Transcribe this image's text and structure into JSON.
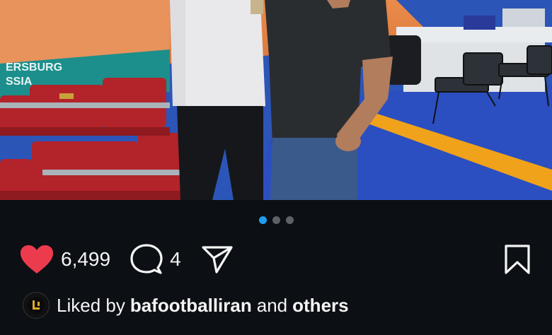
{
  "post": {
    "photo_alt": "Two men standing beside volleyball court seating",
    "arena_banner_text": "ERSBURG\nSSIA",
    "carousel": {
      "total": 3,
      "active_index": 0
    },
    "actions": {
      "likes_count": "6,499",
      "comments_count": "4",
      "liked": true,
      "heart_color": "#ed3b4e"
    },
    "liked_by": {
      "prefix": "Liked by",
      "user": "bafootballiran",
      "connector": "and",
      "suffix": "others",
      "avatar_icon": "bafootball-logo-icon"
    },
    "caption_peek": "... . . . . ."
  }
}
